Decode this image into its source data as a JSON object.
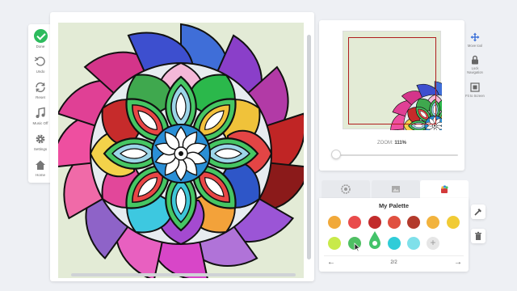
{
  "toolbar": {
    "items": [
      {
        "label": "Done",
        "icon": "check-icon"
      },
      {
        "label": "Undo",
        "icon": "undo-icon"
      },
      {
        "label": "Reset",
        "icon": "reset-icon"
      },
      {
        "label": "Music Off",
        "icon": "music-icon"
      },
      {
        "label": "Settings",
        "icon": "gear-icon"
      },
      {
        "label": "Home",
        "icon": "home-icon"
      }
    ]
  },
  "navigator": {
    "zoom_label": "ZOOM:",
    "zoom_value": "111%",
    "zoom_level": 0.0
  },
  "right_tools": {
    "move_label": "Move tool",
    "lock_label": "Lock Navigation",
    "fit_label": "Fit to Screen"
  },
  "tabs": [
    {
      "icon": "pattern-icon"
    },
    {
      "icon": "image-icon"
    },
    {
      "icon": "palette-pot-icon"
    }
  ],
  "palette": {
    "title": "My Palette",
    "page": "2/2",
    "row1": [
      "#f1a93a",
      "#e94b4b",
      "#c22c2c",
      "#e05040",
      "#b33a2c",
      "#f2b33d",
      "#f1cb35"
    ],
    "row2": [
      "#c8ea4a",
      "#4fbf63",
      "#43c36a",
      "#30ccd8",
      "#7fe0ea"
    ],
    "selected_index": 2
  },
  "colors": {
    "accent_green": "#2dbb5d",
    "canvas_bg": "#e3ebd6",
    "thumb_border": "#b01e1e"
  }
}
